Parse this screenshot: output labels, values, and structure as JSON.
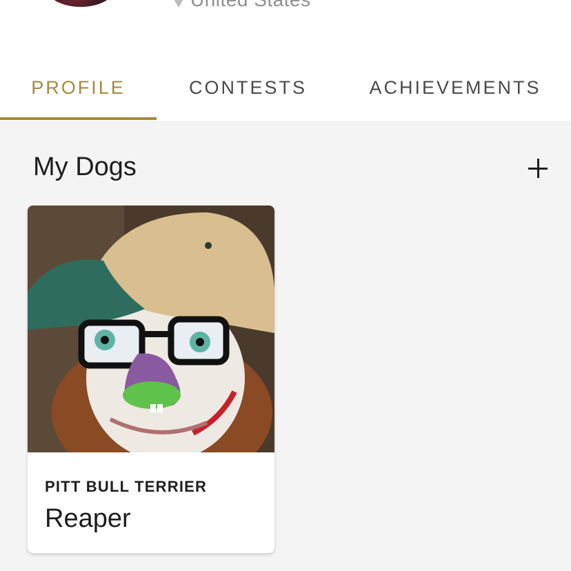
{
  "header": {
    "location": "United States"
  },
  "tabs": [
    {
      "label": "PROFILE",
      "active": true
    },
    {
      "label": "CONTESTS",
      "active": false
    },
    {
      "label": "ACHIEVEMENTS",
      "active": false
    }
  ],
  "section": {
    "title": "My Dogs",
    "add_icon": "plus-icon"
  },
  "dogs": [
    {
      "breed": "PITT BULL TERRIER",
      "name": "Reaper"
    }
  ],
  "colors": {
    "accent": "#a8883a",
    "background": "#f4f4f4",
    "text": "#1e1e1e"
  }
}
